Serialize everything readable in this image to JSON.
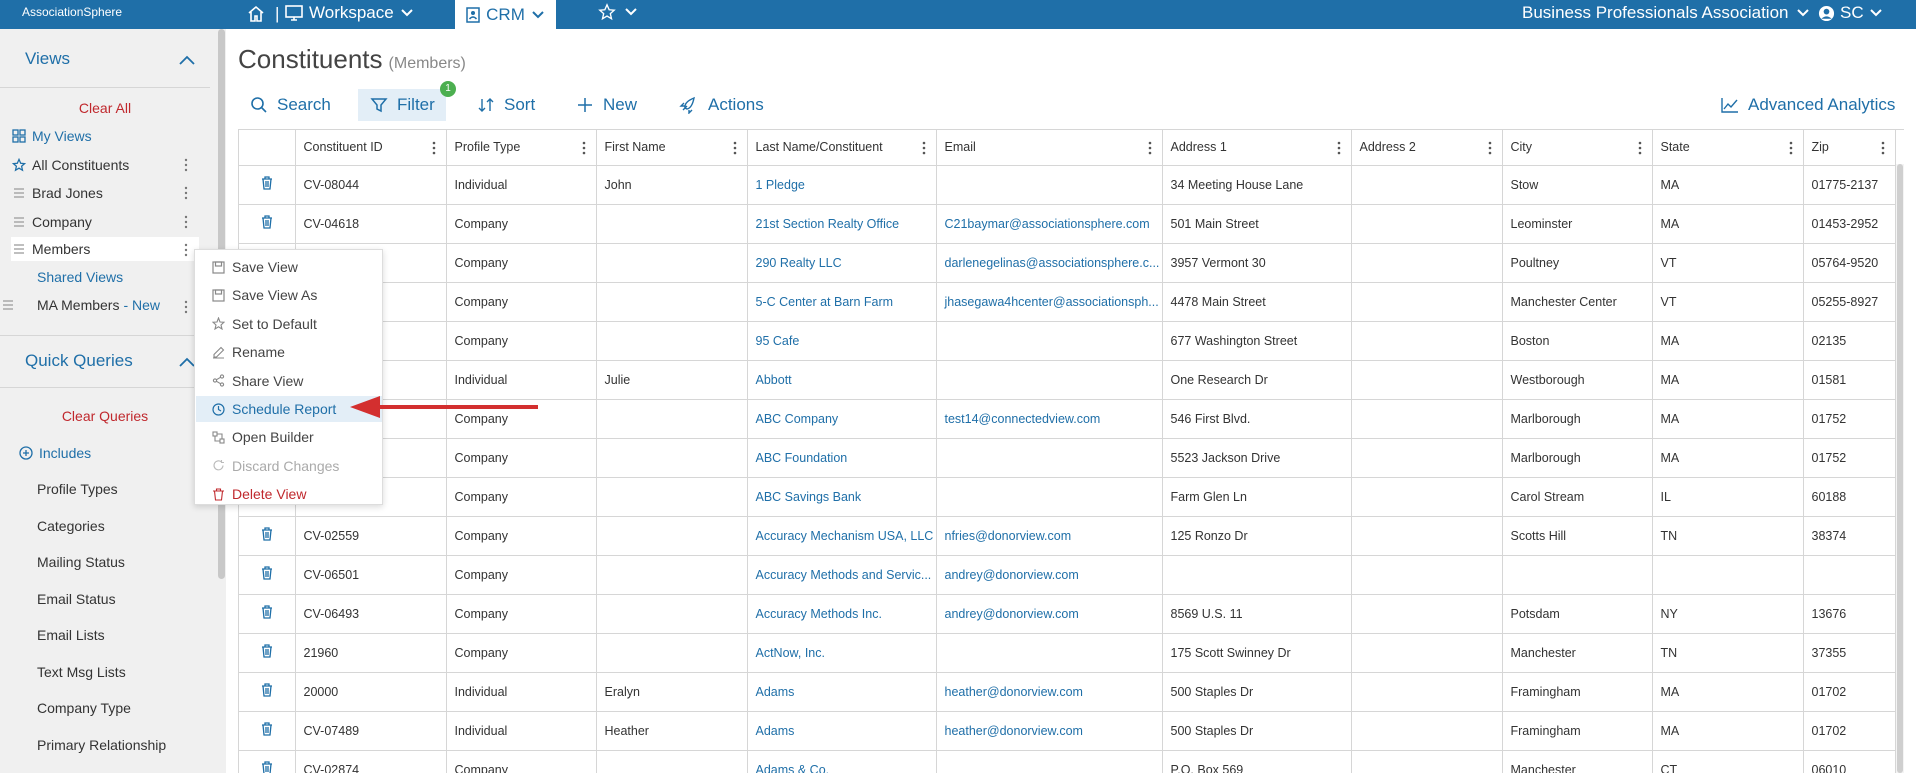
{
  "topbar": {
    "logo_text": "AssociationSphere",
    "workspace_label": "Workspace",
    "crm_label": "CRM",
    "org_label": "Business Professionals Association",
    "user_initials": "SC"
  },
  "sidebar": {
    "views_heading": "Views",
    "clear_all": "Clear All",
    "views": [
      {
        "label": "My Views"
      },
      {
        "label": "All Constituents"
      },
      {
        "label": "Brad Jones"
      },
      {
        "label": "Company"
      },
      {
        "label": "Members"
      },
      {
        "label": "Shared Views"
      },
      {
        "label": "MA Members",
        "tag": "- New"
      }
    ],
    "quick_queries_heading": "Quick Queries",
    "clear_queries": "Clear Queries",
    "includes_label": "Includes",
    "query_items": [
      "Profile Types",
      "Categories",
      "Mailing Status",
      "Email Status",
      "Email Lists",
      "Text Msg Lists",
      "Company Type",
      "Primary Relationship"
    ]
  },
  "main": {
    "title": "Constituents",
    "subtitle": "(Members)",
    "toolbar": {
      "search": "Search",
      "filter": "Filter",
      "filter_count": "1",
      "sort": "Sort",
      "new": "New",
      "actions": "Actions",
      "analytics": "Advanced Analytics"
    }
  },
  "grid": {
    "columns": [
      "",
      "Constituent ID",
      "Profile Type",
      "First Name",
      "Last Name/Constituent",
      "Email",
      "Address 1",
      "Address 2",
      "City",
      "State",
      "Zip"
    ],
    "rows": [
      [
        "CV-08044",
        "Individual",
        "John",
        "1 Pledge",
        "",
        "34 Meeting House Lane",
        "",
        "Stow",
        "MA",
        "01775-2137"
      ],
      [
        "CV-04618",
        "Company",
        "",
        "21st Section Realty Office",
        "C21baymar@associationsphere.com",
        "501 Main Street",
        "",
        "Leominster",
        "MA",
        "01453-2952"
      ],
      [
        "",
        "Company",
        "",
        "290 Realty LLC",
        "darlenegelinas@associationsphere.c...",
        "3957 Vermont 30",
        "",
        "Poultney",
        "VT",
        "05764-9520"
      ],
      [
        "",
        "Company",
        "",
        "5-C Center at Barn Farm",
        "jhasegawa4hcenter@associationsph...",
        "4478 Main Street",
        "",
        "Manchester Center",
        "VT",
        "05255-8927"
      ],
      [
        "",
        "Company",
        "",
        "95 Cafe",
        "",
        "677 Washington Street",
        "",
        "Boston",
        "MA",
        "02135"
      ],
      [
        "",
        "Individual",
        "Julie",
        "Abbott",
        "",
        "One Research Dr",
        "",
        "Westborough",
        "MA",
        "01581"
      ],
      [
        "",
        "Company",
        "",
        "ABC Company",
        "test14@connectedview.com",
        "546 First Blvd.",
        "",
        "Marlborough",
        "MA",
        "01752"
      ],
      [
        "",
        "Company",
        "",
        "ABC Foundation",
        "",
        "5523 Jackson Drive",
        "",
        "Marlborough",
        "MA",
        "01752"
      ],
      [
        "",
        "Company",
        "",
        "ABC Savings Bank",
        "",
        "Farm Glen Ln",
        "",
        "Carol Stream",
        "IL",
        "60188"
      ],
      [
        "CV-02559",
        "Company",
        "",
        "Accuracy Mechanism USA, LLC",
        "nfries@donorview.com",
        "125 Ronzo Dr",
        "",
        "Scotts Hill",
        "TN",
        "38374"
      ],
      [
        "CV-06501",
        "Company",
        "",
        "Accuracy Methods and Servic...",
        "andrey@donorview.com",
        "",
        "",
        "",
        "",
        ""
      ],
      [
        "CV-06493",
        "Company",
        "",
        "Accuracy Methods Inc.",
        "andrey@donorview.com",
        "8569 U.S. 11",
        "",
        "Potsdam",
        "NY",
        "13676"
      ],
      [
        "21960",
        "Company",
        "",
        "ActNow, Inc.",
        "",
        "175 Scott Swinney Dr",
        "",
        "Manchester",
        "TN",
        "37355"
      ],
      [
        "20000",
        "Individual",
        "Eralyn",
        "Adams",
        "heather@donorview.com",
        "500 Staples Dr",
        "",
        "Framingham",
        "MA",
        "01702"
      ],
      [
        "CV-07489",
        "Individual",
        "Heather",
        "Adams",
        "heather@donorview.com",
        "500 Staples Dr",
        "",
        "Framingham",
        "MA",
        "01702"
      ],
      [
        "CV-02874",
        "Company",
        "",
        "Adams & Co.",
        "",
        "P.O. Box 569",
        "",
        "Manchester",
        "CT",
        "06010"
      ]
    ]
  },
  "context_menu": {
    "items": [
      {
        "label": "Save View",
        "icon": "save-icon"
      },
      {
        "label": "Save View As",
        "icon": "save-as-icon"
      },
      {
        "label": "Set to Default",
        "icon": "star-icon"
      },
      {
        "label": "Rename",
        "icon": "edit-icon"
      },
      {
        "label": "Share View",
        "icon": "share-icon"
      },
      {
        "label": "Schedule Report",
        "icon": "clock-icon"
      },
      {
        "label": "Open Builder",
        "icon": "builder-icon"
      },
      {
        "label": "Discard Changes",
        "icon": "refresh-icon"
      },
      {
        "label": "Delete View",
        "icon": "trash-icon"
      }
    ]
  },
  "colors": {
    "brand": "#1f6fa8",
    "danger": "#c0282d",
    "highlight": "#e3eef7",
    "badge": "#4caf50",
    "arrow": "#d32f2f"
  }
}
